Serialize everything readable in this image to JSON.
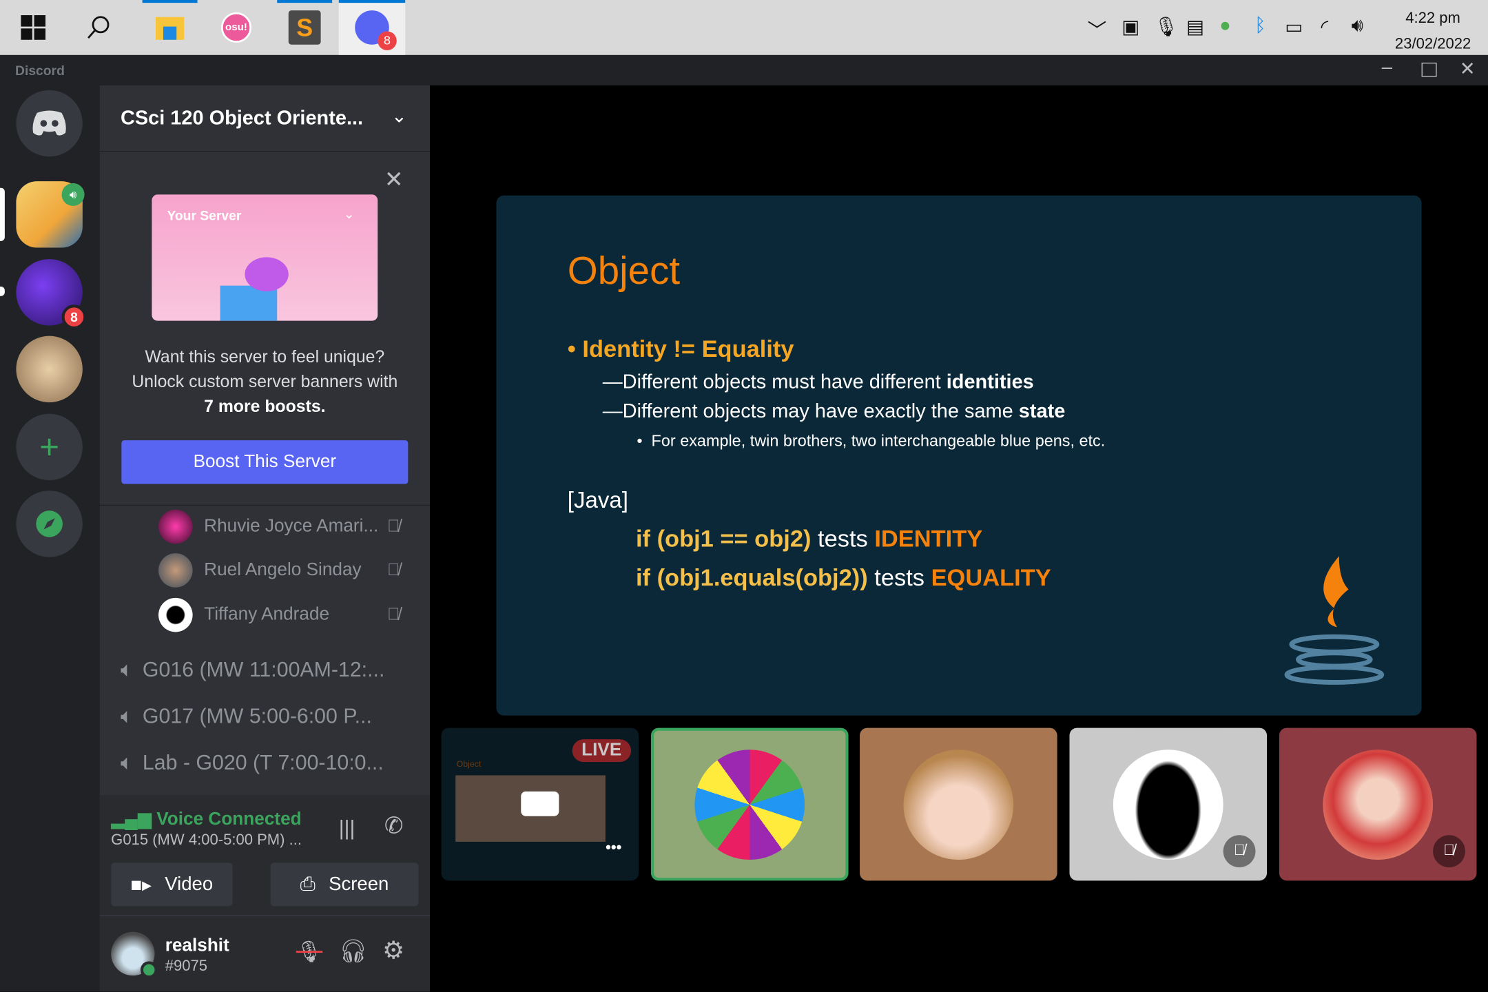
{
  "taskbar": {
    "time": "4:22 pm",
    "date": "23/02/2022",
    "osu_label": "osu!",
    "discord_badge": "8"
  },
  "window": {
    "title": "Discord"
  },
  "rail": {
    "badge": "8"
  },
  "server": {
    "name": "CSci 120 Object Oriente..."
  },
  "boost": {
    "preview_title": "Your Server",
    "text1": "Want this server to feel unique? Unlock custom server banners with",
    "text2": "7 more boosts.",
    "button": "Boost This Server"
  },
  "members": [
    {
      "name": "Rhuvie Joyce Amari..."
    },
    {
      "name": "Ruel Angelo Sinday"
    },
    {
      "name": "Tiffany Andrade"
    }
  ],
  "channels": [
    {
      "name": "G016 (MW 11:00AM-12:..."
    },
    {
      "name": "G017 (MW 5:00-6:00 P..."
    },
    {
      "name": "Lab - G020 (T 7:00-10:0..."
    }
  ],
  "voice": {
    "status": "Voice Connected",
    "channel": "G015 (MW 4:00-5:00 PM) ...",
    "video": "Video",
    "screen": "Screen"
  },
  "user": {
    "name": "realshit",
    "tag": "#9075"
  },
  "slide": {
    "title": "Object",
    "bullet": "Identity != Equality",
    "sub1a": "Different objects must have different ",
    "sub1b": "identities",
    "sub2a": "Different objects may have exactly the same ",
    "sub2b": "state",
    "example": "For example, twin brothers, two interchangeable blue pens, etc.",
    "java": "[Java]",
    "code1a": "if (obj1 == obj2)",
    "code1b": " tests ",
    "code1c": "IDENTITY",
    "code2a": "if (obj1.equals(obj2))",
    "code2b": " tests ",
    "code2c": "EQUALITY"
  },
  "stream": {
    "live": "LIVE",
    "mini_title": "Object"
  },
  "colors": {
    "accent": "#5865f2",
    "green": "#3ba55d",
    "slide_orange": "#f5820d"
  }
}
